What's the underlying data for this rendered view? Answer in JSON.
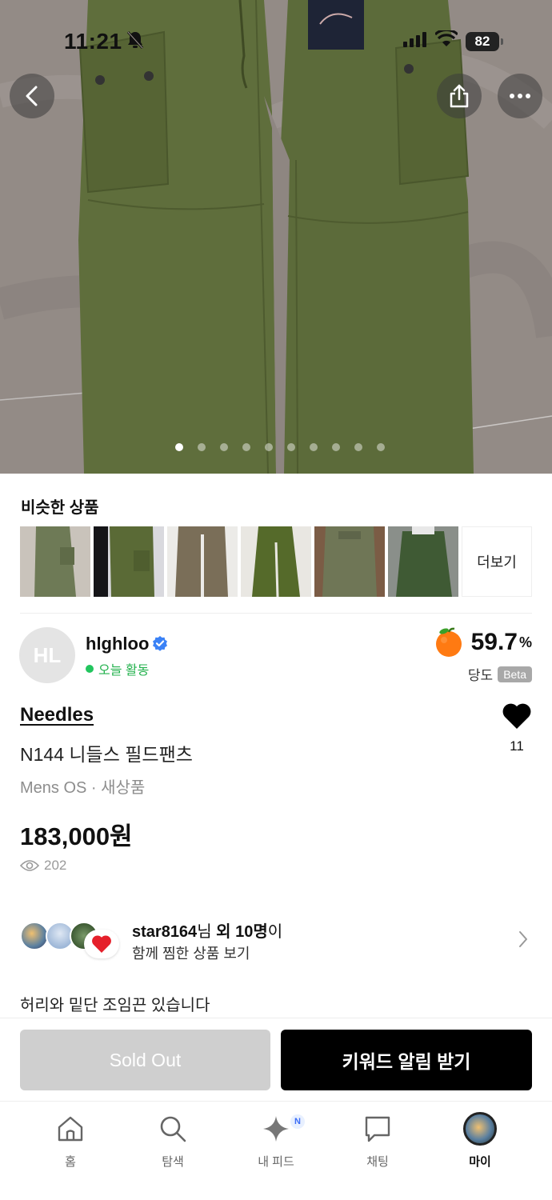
{
  "status": {
    "time": "11:21",
    "battery": "82"
  },
  "hero": {
    "image_count": 10,
    "active_index": 0
  },
  "similar": {
    "title": "비슷한 상품",
    "more_label": "더보기",
    "thumbs": [
      "olive-cargo-1",
      "olive-cargo-2",
      "khaki-cargo",
      "olive-cargo-3",
      "olive-wide",
      "olive-cargo-4"
    ]
  },
  "seller": {
    "initials": "HL",
    "name": "hlghloo",
    "activity": "오늘 활동",
    "score_value": "59.7",
    "score_unit": "%",
    "score_label": "당도",
    "beta": "Beta"
  },
  "product": {
    "brand": "Needles",
    "name": "N144 니들스 필드팬츠",
    "sub": "Mens OS · 새상품",
    "price": "183,000원",
    "views": "202",
    "likes": "11",
    "description": "허리와 밑단 조임끈 있습니다"
  },
  "liked_with": {
    "user": "star8164",
    "text_mid": "님 ",
    "others": "외 10명",
    "text_end": "이",
    "line2": "함께 찜한 상품 보기"
  },
  "actions": {
    "sold_out": "Sold Out",
    "keyword_alert": "키워드 알림 받기"
  },
  "tabs": [
    {
      "label": "홈"
    },
    {
      "label": "탐색"
    },
    {
      "label": "내 피드",
      "badge": "N"
    },
    {
      "label": "채팅"
    },
    {
      "label": "마이"
    }
  ],
  "colors": {
    "accent_green": "#22c55e",
    "pants_olive": "#5f6e3c",
    "verified_blue": "#3b82f6"
  }
}
